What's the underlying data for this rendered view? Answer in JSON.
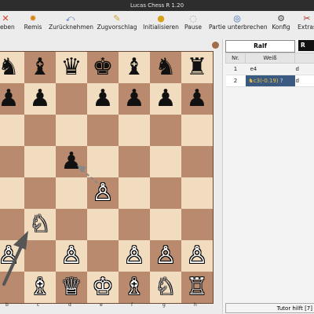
{
  "window": {
    "title": "Lucas Chess R 1.20"
  },
  "toolbar": {
    "items": [
      {
        "label": "geben",
        "icon": "✕",
        "color": "#d23a2a"
      },
      {
        "label": "Remis",
        "icon": "✸",
        "color": "#d9861a"
      },
      {
        "label": "Zurücknehmen",
        "icon": "⤺",
        "color": "#4b78b5"
      },
      {
        "label": "Zugvorschlag",
        "icon": "✎",
        "color": "#d0a13a"
      },
      {
        "label": "Initialisieren",
        "icon": "●",
        "color": "#d6a21a"
      },
      {
        "label": "Pause",
        "icon": "◌",
        "color": "#9a9a9a"
      },
      {
        "label": "Partie unterbrechen",
        "icon": "◎",
        "color": "#3667b5"
      },
      {
        "label": "Konfig",
        "icon": "⚙",
        "color": "#444444"
      },
      {
        "label": "Extras",
        "icon": "✂",
        "color": "#b02a2a"
      }
    ]
  },
  "board": {
    "files": [
      "b",
      "c",
      "d",
      "e",
      "f",
      "g",
      "h"
    ],
    "rows": [
      [
        "♞",
        "♝",
        "♛",
        "♚",
        "♝",
        "♞",
        "♜"
      ],
      [
        "♟",
        "♟",
        "",
        "♟",
        "♟",
        "♟",
        "♟"
      ],
      [
        "",
        "",
        "",
        "",
        "",
        "",
        ""
      ],
      [
        "",
        "",
        "♟",
        "",
        "",
        "",
        ""
      ],
      [
        "",
        "",
        "",
        "♙",
        "",
        "",
        ""
      ],
      [
        "",
        "♘",
        "",
        "",
        "",
        "",
        ""
      ],
      [
        "♙",
        "",
        "♙",
        "",
        "♙",
        "♙",
        "♙"
      ],
      [
        "",
        "♗",
        "♕",
        "♔",
        "♗",
        "♘",
        "♖"
      ]
    ]
  },
  "players": {
    "white": "Ralf",
    "black": "R"
  },
  "moves": {
    "headers": [
      "Nr.",
      "Weiß",
      ""
    ],
    "rows": [
      {
        "nr": "1",
        "white": "e4",
        "black": "d"
      },
      {
        "nr": "2",
        "white": "♞c3(-0.19)",
        "black": "d",
        "mark": "?"
      }
    ]
  },
  "tutor": {
    "label": "Tutor hilft [7]"
  }
}
